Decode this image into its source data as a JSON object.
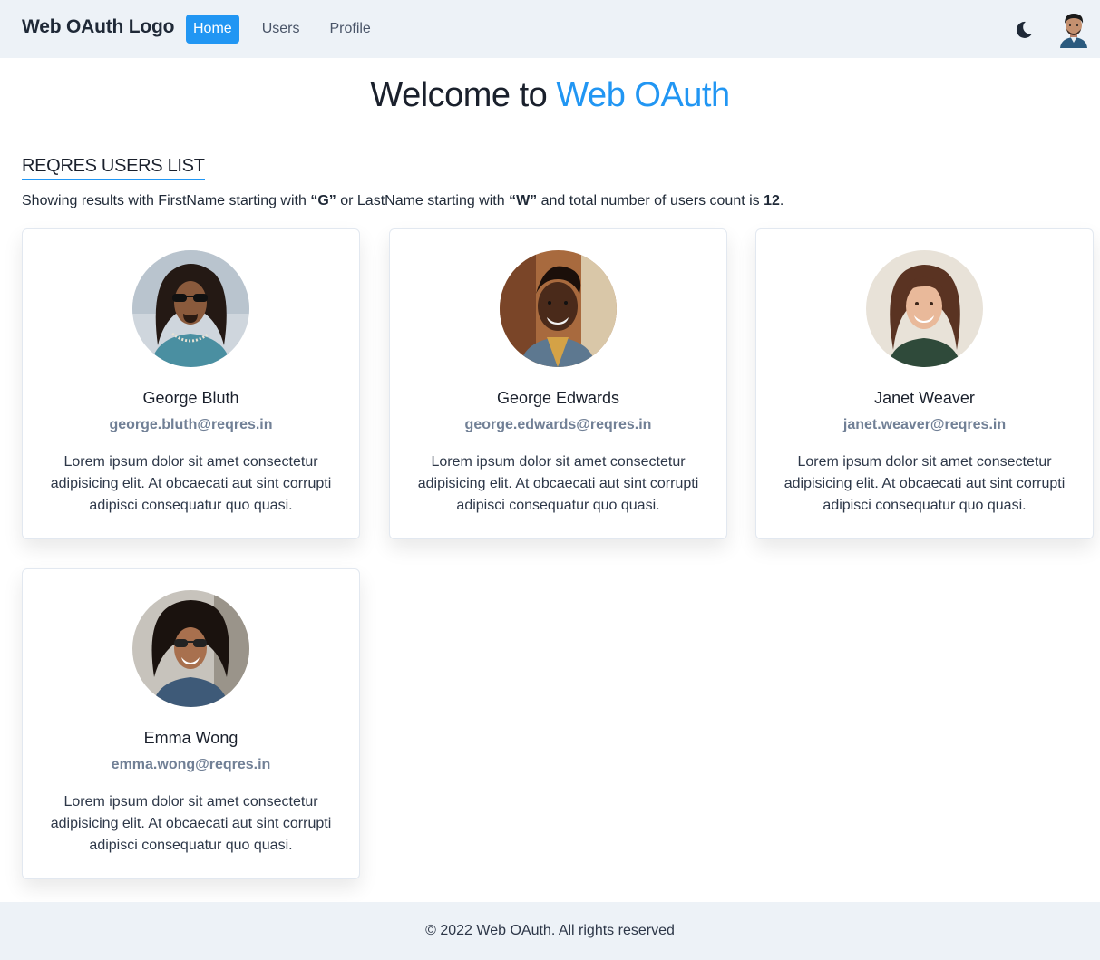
{
  "navbar": {
    "logo": "Web OAuth Logo",
    "links": [
      "Home",
      "Users",
      "Profile"
    ],
    "active": "Home",
    "theme_icon": "moon-icon",
    "avatar_icon": "user-avatar"
  },
  "hero": {
    "prefix": "Welcome to ",
    "accent": "Web OAuth"
  },
  "section": {
    "title": "REQRES USERS LIST",
    "summary_parts": {
      "a": "Showing results with FirstName starting with ",
      "b": "“G”",
      "c": " or LastName starting with ",
      "d": "“W”",
      "e": " and total number of users count is ",
      "f": "12",
      "g": "."
    }
  },
  "users": [
    {
      "name": "George Bluth",
      "email": "george.bluth@reqres.in",
      "bio": "Lorem ipsum dolor sit amet consectetur adipisicing elit. At obcaecati aut sint corrupti adipisci consequatur quo quasi."
    },
    {
      "name": "George Edwards",
      "email": "george.edwards@reqres.in",
      "bio": "Lorem ipsum dolor sit amet consectetur adipisicing elit. At obcaecati aut sint corrupti adipisci consequatur quo quasi."
    },
    {
      "name": "Janet Weaver",
      "email": "janet.weaver@reqres.in",
      "bio": "Lorem ipsum dolor sit amet consectetur adipisicing elit. At obcaecati aut sint corrupti adipisci consequatur quo quasi."
    },
    {
      "name": "Emma Wong",
      "email": "emma.wong@reqres.in",
      "bio": "Lorem ipsum dolor sit amet consectetur adipisicing elit. At obcaecati aut sint corrupti adipisci consequatur quo quasi."
    }
  ],
  "footer": {
    "text": "© 2022 Web OAuth. All rights reserved"
  },
  "colors": {
    "accent": "#2196f3",
    "navbar_bg": "#edf2f7",
    "email": "#718096"
  }
}
